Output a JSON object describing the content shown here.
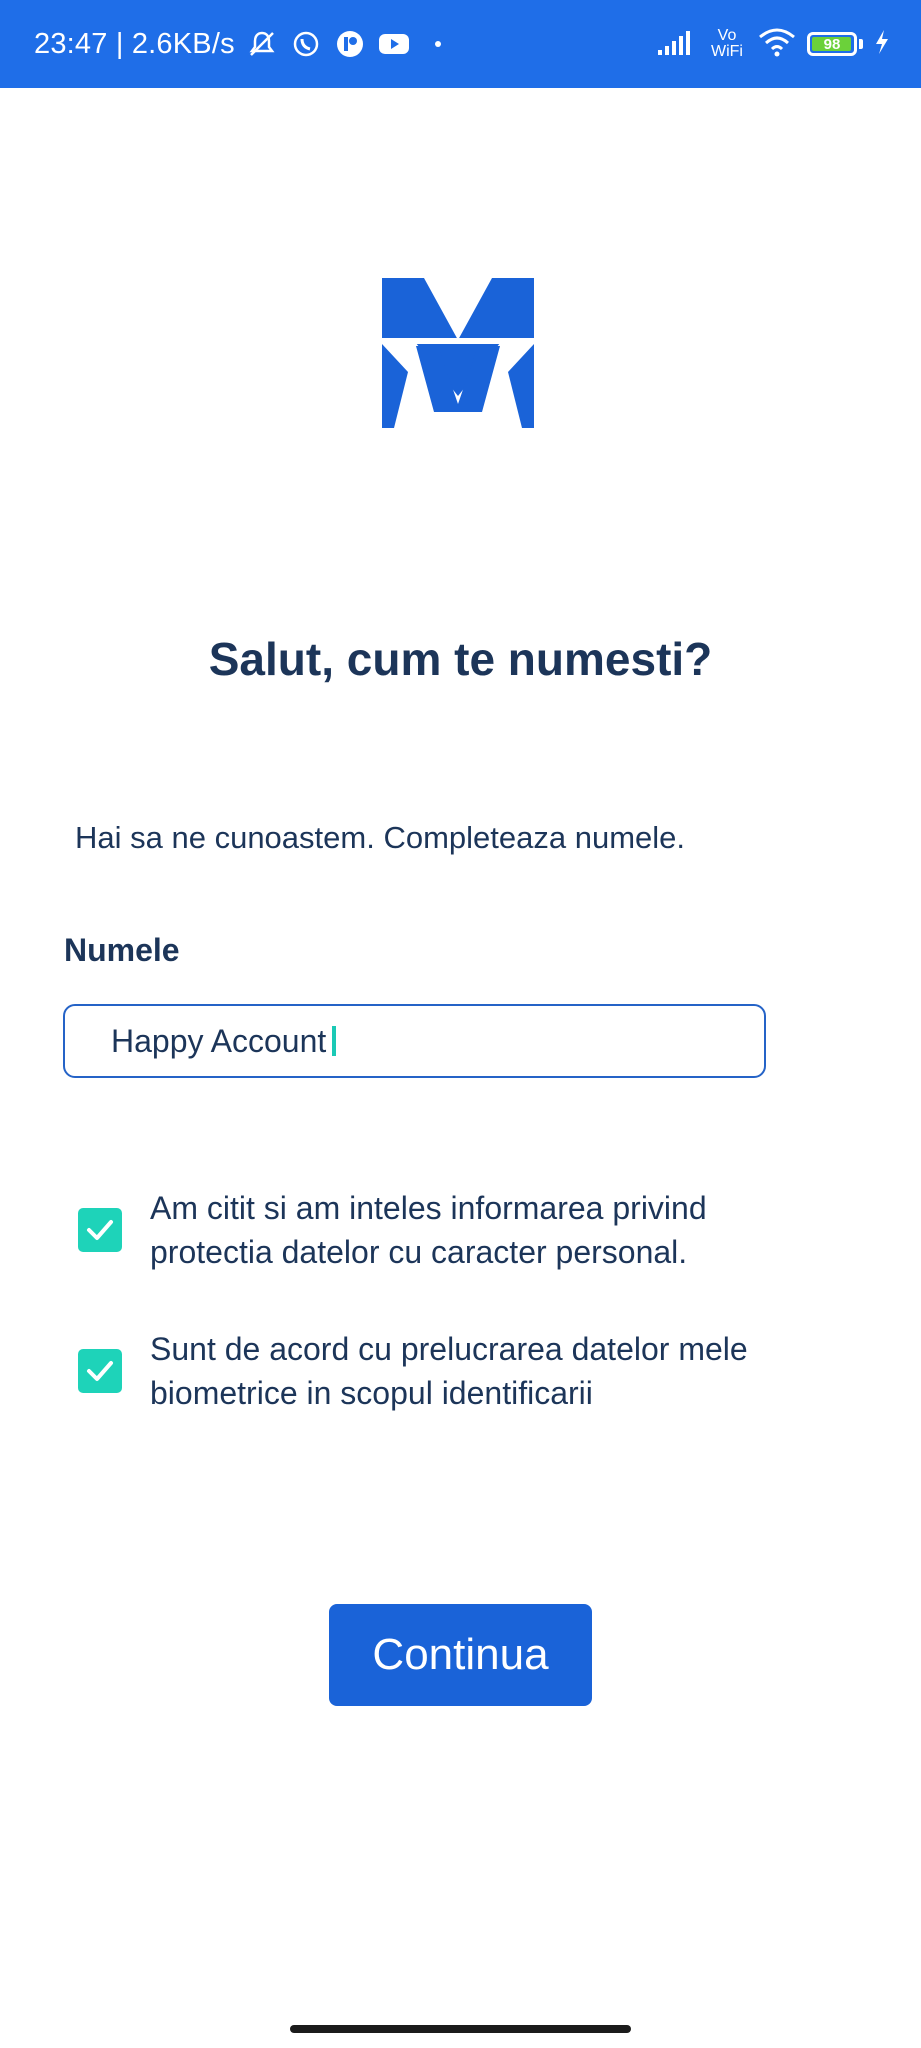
{
  "status_bar": {
    "time": "23:47 | 2.6KB/s",
    "volte_label": "Vo WiFi",
    "battery_level": "98",
    "icons": [
      "mute-icon",
      "whatsapp-icon",
      "app-icon",
      "youtube-icon",
      "dot-icon",
      "signal-icon",
      "wifi-icon",
      "battery-icon",
      "charging-icon"
    ],
    "background_color": "#1f6ee8"
  },
  "logo": {
    "icon": "m-logo-icon",
    "color": "#1a63d8"
  },
  "main": {
    "title": "Salut, cum te numesti?",
    "subtitle": "Hai sa ne cunoastem. Completeaza numele.",
    "name_label": "Numele",
    "name_value": "Happy Account"
  },
  "consents": [
    {
      "line1": "Am citit si am inteles informarea privind",
      "line2": "protectia datelor cu caracter personal.",
      "checked": true
    },
    {
      "line1": "Sunt de acord cu prelucrarea datelor mele",
      "line2": "biometrice in scopul identificarii",
      "checked": true
    }
  ],
  "actions": {
    "continue_label": "Continua",
    "primary_color": "#1a63d8",
    "check_color": "#1ed3b9"
  }
}
